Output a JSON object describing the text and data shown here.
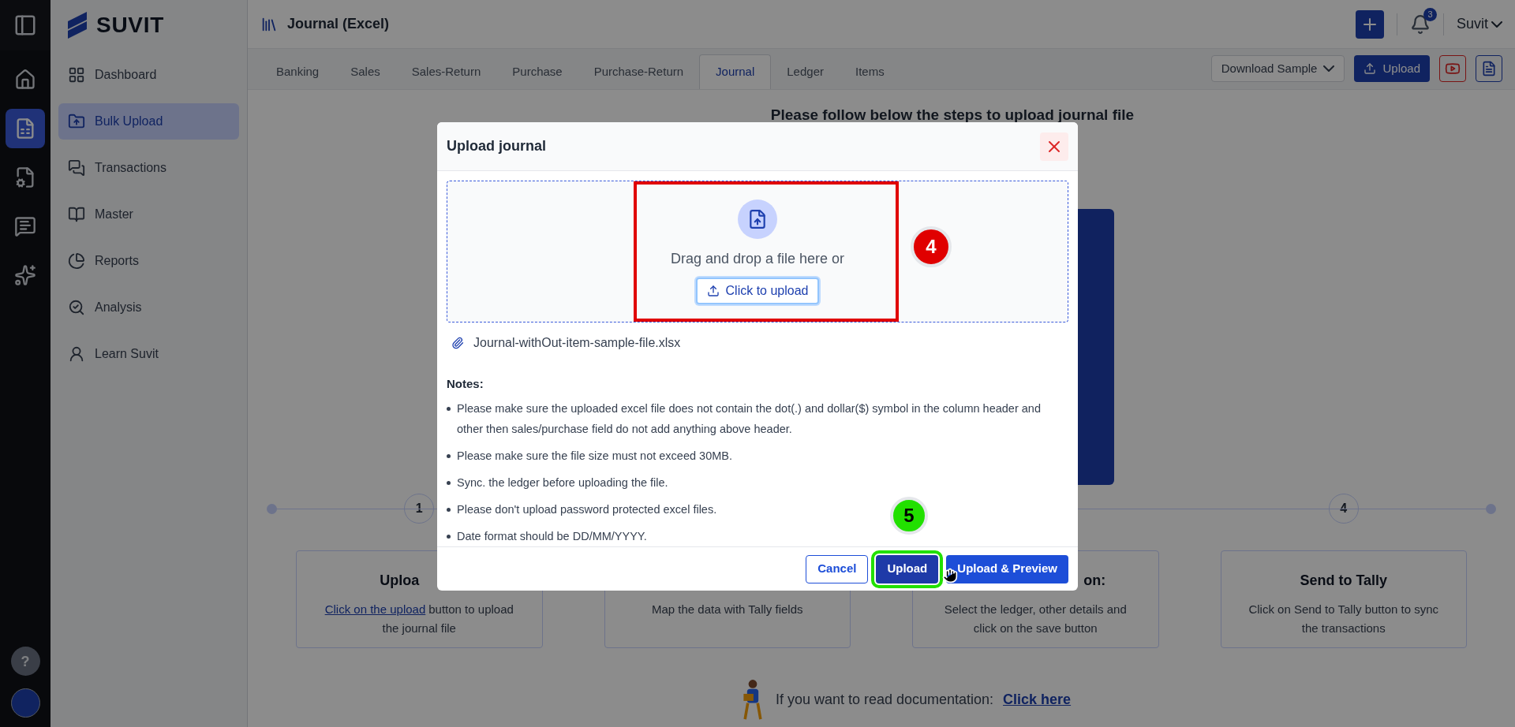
{
  "rail": {
    "items": [
      {
        "kind": "home",
        "selected": false
      },
      {
        "kind": "bulk",
        "selected": true
      },
      {
        "kind": "gst",
        "selected": false
      },
      {
        "kind": "chat",
        "selected": false
      },
      {
        "kind": "ai",
        "selected": false
      }
    ],
    "help": "?"
  },
  "brand": "SUVIT",
  "sidebar": {
    "items": [
      {
        "label": "Dashboard",
        "selected": false
      },
      {
        "label": "Bulk Upload",
        "selected": true
      },
      {
        "label": "Transactions",
        "selected": false
      },
      {
        "label": "Master",
        "selected": false
      },
      {
        "label": "Reports",
        "selected": false
      },
      {
        "label": "Analysis",
        "selected": false
      },
      {
        "label": "Learn Suvit",
        "selected": false
      }
    ]
  },
  "header": {
    "title": "Journal (Excel)",
    "notifications": "3",
    "user": "Suvit"
  },
  "tabs": [
    {
      "label": "Banking",
      "selected": false
    },
    {
      "label": "Sales",
      "selected": false
    },
    {
      "label": "Sales-Return",
      "selected": false
    },
    {
      "label": "Purchase",
      "selected": false
    },
    {
      "label": "Purchase-Return",
      "selected": false
    },
    {
      "label": "Journal",
      "selected": true
    },
    {
      "label": "Ledger",
      "selected": false
    },
    {
      "label": "Items",
      "selected": false
    }
  ],
  "toolbar": {
    "download": "Download Sample",
    "upload": "Upload"
  },
  "main": {
    "heading": "Please follow below the steps to upload journal file",
    "step_numbers": [
      "1",
      "4"
    ],
    "steps": [
      {
        "title": "Uploa",
        "link": "Click on the upload",
        "lines": [
          "button to upload",
          "the journal file"
        ]
      },
      {
        "lines": [
          "Map the data with Tally fields"
        ]
      },
      {
        "title": "on:",
        "lines": [
          "Select the ledger, other details and",
          "click on the save button"
        ]
      },
      {
        "title": "Send to Tally",
        "lines": [
          "Click on Send to Tally button to sync",
          "the transactions"
        ]
      }
    ],
    "doc_text": "If you want to read documentation:",
    "doc_link": "Click here"
  },
  "modal": {
    "title": "Upload journal",
    "drop_text": "Drag and drop a file here or",
    "drop_button": "Click to upload",
    "file": "Journal-withOut-item-sample-file.xlsx",
    "notes_title": "Notes:",
    "notes": [
      "Please make sure the uploaded excel file does not contain the dot(.) and dollar($) symbol in the column header and other then sales/purchase field do not add anything above header.",
      "Please make sure the file size must not exceed 30MB.",
      "Sync. the ledger before uploading the file.",
      "Please don't upload password protected excel files.",
      "Date format should be DD/MM/YYYY."
    ],
    "buttons": [
      {
        "label": "Cancel",
        "kind": "outline"
      },
      {
        "label": "Upload",
        "kind": "dark"
      },
      {
        "label": "Upload & Preview",
        "kind": "primary"
      }
    ]
  },
  "annotations": [
    {
      "label": "4",
      "color": "#e00000"
    },
    {
      "label": "5",
      "color": "#22e000"
    }
  ]
}
